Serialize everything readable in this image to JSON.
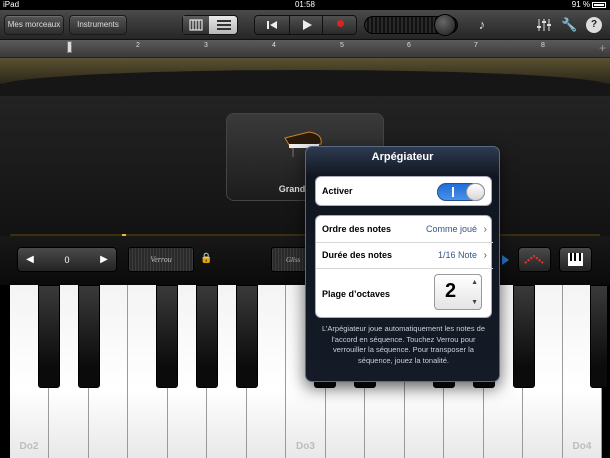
{
  "status_bar": {
    "device": "iPad",
    "time": "01:58",
    "battery": "91 %"
  },
  "toolbar": {
    "songs_label": "Mes morceaux",
    "instruments_label": "Instruments"
  },
  "ruler": {
    "marks": [
      "1",
      "2",
      "3",
      "4",
      "5",
      "6",
      "7",
      "8"
    ]
  },
  "instrument": {
    "name": "Grand"
  },
  "controls": {
    "octave_value": "0",
    "hold_label": "Verrou",
    "glissando_label": "Gliss"
  },
  "keyboard": {
    "labels": [
      "Do2",
      "Do3",
      "Do4"
    ]
  },
  "arpeggiator": {
    "title": "Arpégiateur",
    "enable_label": "Activer",
    "enabled": true,
    "note_order_label": "Ordre des notes",
    "note_order_value": "Comme joué",
    "note_rate_label": "Durée des notes",
    "note_rate_value": "1/16 Note",
    "octave_range_label": "Plage d’octaves",
    "octave_range_value": "2",
    "footer": "L’Arpégiateur joue automatiquement les notes de l’accord en séquence. Touchez Verrou pour verrouiller la séquence. Pour transposer la séquence, jouez la tonalité."
  },
  "colors": {
    "accent": "#2a76d2",
    "gold": "#e8b63a",
    "record": "#d22222"
  }
}
